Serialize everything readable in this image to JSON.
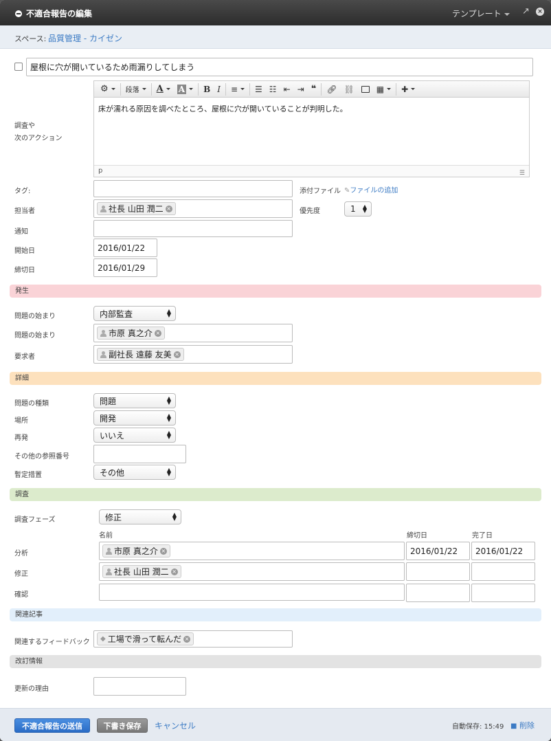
{
  "window": {
    "title": "不適合報告の編集",
    "template_label": "テンプレート",
    "expand_icon": "↗",
    "close_icon": "×"
  },
  "space": {
    "label": "スペース:",
    "value": "品質管理 - カイゼン"
  },
  "subject": {
    "checked": false,
    "value": "屋根に穴が開いているため雨漏りしてしまう"
  },
  "editor": {
    "label_line1": "調査や",
    "label_line2": "次のアクション",
    "toolbar": {
      "paragraph": "段落",
      "bold": "B",
      "italic": "I",
      "font_color": "A",
      "bg_color": "A"
    },
    "content": "床が濡れる原因を調べたところ、屋根に穴が開いていることが判明した。",
    "status_path": "p"
  },
  "fields": {
    "tags_label": "タグ:",
    "tags_value": "",
    "attach_label": "添付ファイル",
    "attach_link": "ファイルの追加",
    "assignee_label": "担当者",
    "assignee_chip": "社長 山田 潤二",
    "priority_label": "優先度",
    "priority_value": "1",
    "notify_label": "通知",
    "start_label": "開始日",
    "start_value": "2016/01/22",
    "due_label": "締切日",
    "due_value": "2016/01/29"
  },
  "occurrence": {
    "section_title": "発生",
    "origin_label": "問題の始まり",
    "origin_value": "内部監査",
    "origin_person_label": "問題の始まり",
    "origin_person_chip": "市原 真之介",
    "requester_label": "要求者",
    "requester_chip": "副社長 遠藤 友美"
  },
  "details": {
    "section_title": "詳細",
    "type_label": "問題の種類",
    "type_value": "問題",
    "place_label": "場所",
    "place_value": "開発",
    "recur_label": "再発",
    "recur_value": "いいえ",
    "ref_label": "その他の参照番号",
    "ref_value": "",
    "interim_label": "暫定措置",
    "interim_value": "その他"
  },
  "investigation": {
    "section_title": "調査",
    "phase_label": "調査フェーズ",
    "phase_value": "修正",
    "col_name": "名前",
    "col_due": "締切日",
    "col_done": "完了日",
    "rows": [
      {
        "label": "分析",
        "chip": "市原 真之介",
        "due": "2016/01/22",
        "done": "2016/01/22"
      },
      {
        "label": "修正",
        "chip": "社長 山田 潤二",
        "due": "",
        "done": ""
      },
      {
        "label": "確認",
        "chip": "",
        "due": "",
        "done": ""
      }
    ]
  },
  "related": {
    "section_title": "関連記事",
    "feedback_label": "関連するフィードバック",
    "feedback_chip": "工場で滑って転んだ"
  },
  "revision": {
    "section_title": "改訂情報",
    "reason_label": "更新の理由",
    "reason_value": ""
  },
  "footer": {
    "submit": "不適合報告の送信",
    "draft": "下書き保存",
    "cancel": "キャンセル",
    "autosave": "自動保存: 15:49",
    "delete": "削除"
  },
  "colors": {
    "occurrence_bg": "#fad3d7",
    "details_bg": "#fde1bd",
    "investigation_bg": "#dcebcc",
    "related_bg": "#e2effb",
    "revision_bg": "#e3e3e3",
    "primary": "#2a6cc6"
  }
}
